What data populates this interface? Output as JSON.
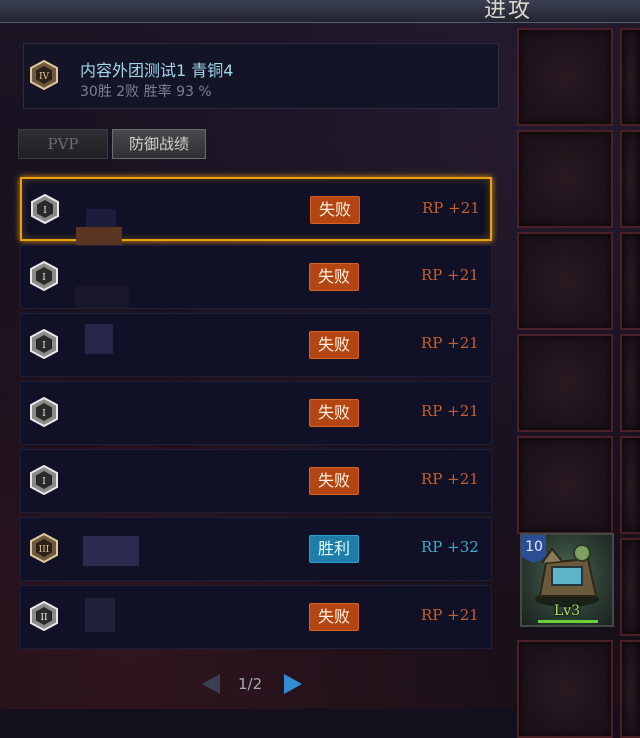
{
  "header": {
    "title": "进攻"
  },
  "profile": {
    "rank_numeral": "IV",
    "name": "内容外团测试1  青铜4",
    "stats": "30胜 2败 胜率 93 %"
  },
  "tabs": [
    {
      "label": "PVP"
    },
    {
      "label": "防御战绩"
    }
  ],
  "records": [
    {
      "rank_numeral": "I",
      "result": "失败",
      "rp": "RP +21",
      "outcome": "loss",
      "selected": true
    },
    {
      "rank_numeral": "I",
      "result": "失败",
      "rp": "RP +21",
      "outcome": "loss"
    },
    {
      "rank_numeral": "I",
      "result": "失败",
      "rp": "RP +21",
      "outcome": "loss"
    },
    {
      "rank_numeral": "I",
      "result": "失败",
      "rp": "RP +21",
      "outcome": "loss"
    },
    {
      "rank_numeral": "I",
      "result": "失败",
      "rp": "RP +21",
      "outcome": "loss"
    },
    {
      "rank_numeral": "III",
      "result": "胜利",
      "rp": "RP +32",
      "outcome": "win"
    },
    {
      "rank_numeral": "II",
      "result": "失败",
      "rp": "RP +21",
      "outcome": "loss"
    }
  ],
  "pagination": {
    "text": "1/2",
    "prev_icon": "arrow-left-icon",
    "next_icon": "arrow-right-icon"
  },
  "unit_card": {
    "count": "10",
    "level": "Lv3"
  },
  "colors": {
    "loss": "#b34513",
    "win": "#1c7ea8",
    "highlight": "#e8a10e"
  }
}
